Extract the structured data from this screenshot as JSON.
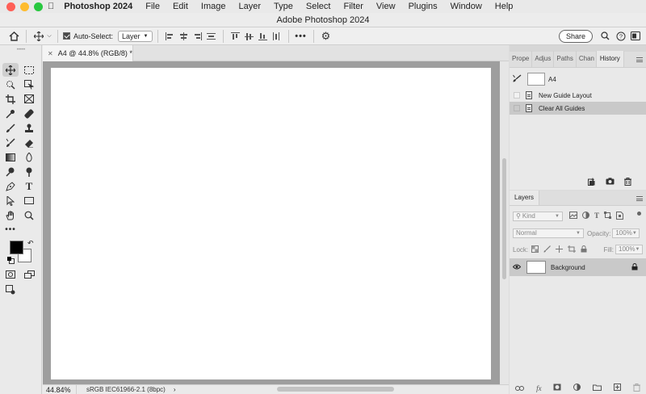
{
  "menubar": {
    "app_name": "Photoshop 2024",
    "items": [
      "File",
      "Edit",
      "Image",
      "Layer",
      "Type",
      "Select",
      "Filter",
      "View",
      "Plugins",
      "Window",
      "Help"
    ],
    "traffic_colors": [
      "#ff5f57",
      "#febc2e",
      "#28c840"
    ]
  },
  "window": {
    "title": "Adobe Photoshop 2024"
  },
  "options_bar": {
    "auto_select_label": "Auto-Select:",
    "auto_select_target": "Layer",
    "share_label": "Share"
  },
  "document": {
    "tab_label": "A4 @ 44.8% (RGB/8) *",
    "zoom": "44.84%",
    "color_profile": "sRGB IEC61966-2.1 (8bpc)"
  },
  "history_panel": {
    "tabs": [
      "Prope",
      "Adjus",
      "Paths",
      "Chan",
      "History"
    ],
    "active_tab": "History",
    "snapshot_label": "A4",
    "entries": [
      "New Guide Layout",
      "Clear All Guides"
    ],
    "selected_entry": "Clear All Guides"
  },
  "layers_panel": {
    "tab": "Layers",
    "filter_kind": "Kind",
    "blend_mode": "Normal",
    "opacity_label": "Opacity:",
    "opacity_value": "100%",
    "lock_label": "Lock:",
    "fill_label": "Fill:",
    "fill_value": "100%",
    "layers": [
      {
        "name": "Background",
        "locked": true,
        "visible": true
      }
    ]
  },
  "colors": {
    "accent_selected": "#c9c9c9",
    "pasteboard": "#9e9e9e",
    "foreground": "#000000",
    "background": "#ffffff"
  }
}
